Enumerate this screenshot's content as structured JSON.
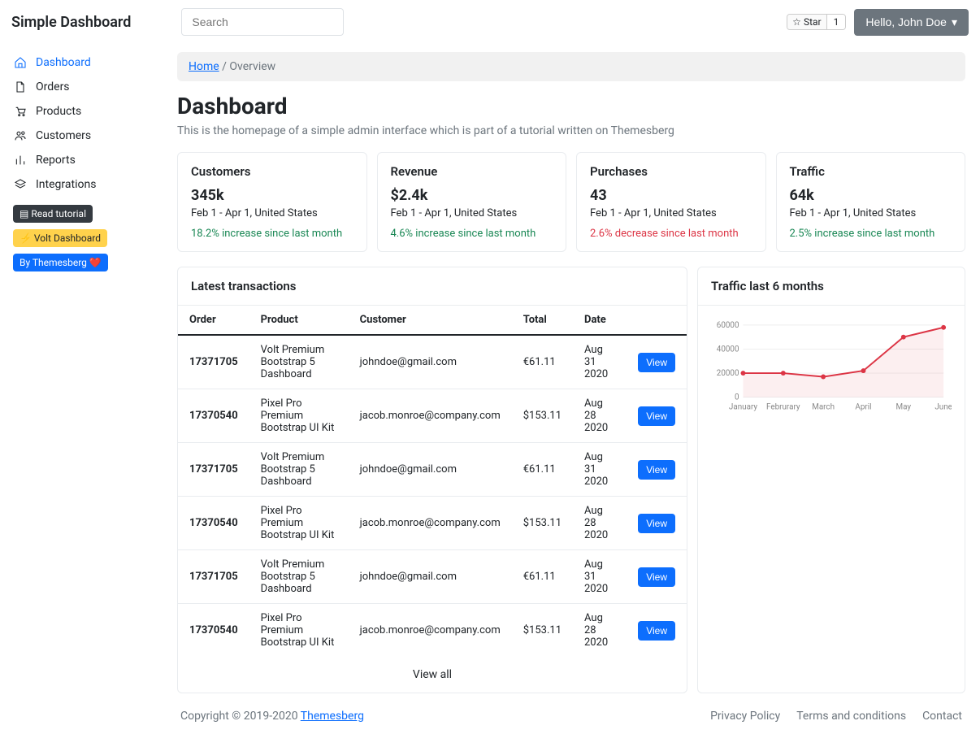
{
  "brand": "Simple Dashboard",
  "search": {
    "placeholder": "Search"
  },
  "star": {
    "label": "Star",
    "count": "1"
  },
  "user": {
    "greeting": "Hello, John Doe"
  },
  "sidebar": {
    "items": [
      {
        "label": "Dashboard"
      },
      {
        "label": "Orders"
      },
      {
        "label": "Products"
      },
      {
        "label": "Customers"
      },
      {
        "label": "Reports"
      },
      {
        "label": "Integrations"
      }
    ],
    "buttons": [
      {
        "label": "Read tutorial"
      },
      {
        "label": "Volt Dashboard"
      },
      {
        "label": "By Themesberg ❤️"
      }
    ]
  },
  "breadcrumb": {
    "home": "Home",
    "sep": "/",
    "current": "Overview"
  },
  "page": {
    "title": "Dashboard",
    "subtitle": "This is the homepage of a simple admin interface which is part of a tutorial written on Themesberg"
  },
  "stats": [
    {
      "label": "Customers",
      "value": "345k",
      "range": "Feb 1 - Apr 1, United States",
      "change": "18.2% increase since last month",
      "dir": "up"
    },
    {
      "label": "Revenue",
      "value": "$2.4k",
      "range": "Feb 1 - Apr 1, United States",
      "change": "4.6% increase since last month",
      "dir": "up"
    },
    {
      "label": "Purchases",
      "value": "43",
      "range": "Feb 1 - Apr 1, United States",
      "change": "2.6% decrease since last month",
      "dir": "down"
    },
    {
      "label": "Traffic",
      "value": "64k",
      "range": "Feb 1 - Apr 1, United States",
      "change": "2.5% increase since last month",
      "dir": "up"
    }
  ],
  "transactions": {
    "title": "Latest transactions",
    "headers": [
      "Order",
      "Product",
      "Customer",
      "Total",
      "Date",
      ""
    ],
    "rows": [
      {
        "order": "17371705",
        "product": "Volt Premium Bootstrap 5 Dashboard",
        "customer": "johndoe@gmail.com",
        "total": "€61.11",
        "date": "Aug 31 2020",
        "action": "View"
      },
      {
        "order": "17370540",
        "product": "Pixel Pro Premium Bootstrap UI Kit",
        "customer": "jacob.monroe@company.com",
        "total": "$153.11",
        "date": "Aug 28 2020",
        "action": "View"
      },
      {
        "order": "17371705",
        "product": "Volt Premium Bootstrap 5 Dashboard",
        "customer": "johndoe@gmail.com",
        "total": "€61.11",
        "date": "Aug 31 2020",
        "action": "View"
      },
      {
        "order": "17370540",
        "product": "Pixel Pro Premium Bootstrap UI Kit",
        "customer": "jacob.monroe@company.com",
        "total": "$153.11",
        "date": "Aug 28 2020",
        "action": "View"
      },
      {
        "order": "17371705",
        "product": "Volt Premium Bootstrap 5 Dashboard",
        "customer": "johndoe@gmail.com",
        "total": "€61.11",
        "date": "Aug 31 2020",
        "action": "View"
      },
      {
        "order": "17370540",
        "product": "Pixel Pro Premium Bootstrap UI Kit",
        "customer": "jacob.monroe@company.com",
        "total": "$153.11",
        "date": "Aug 28 2020",
        "action": "View"
      }
    ],
    "view_all": "View all"
  },
  "chart_panel": {
    "title": "Traffic last 6 months"
  },
  "chart_data": {
    "type": "area",
    "categories": [
      "January",
      "Februrary",
      "March",
      "April",
      "May",
      "June"
    ],
    "values": [
      20000,
      20000,
      17000,
      22000,
      50000,
      58000
    ],
    "ylim": [
      0,
      60000
    ],
    "yticks": [
      0,
      20000,
      40000,
      60000
    ]
  },
  "footer": {
    "copyright_prefix": "Copyright © 2019-2020 ",
    "copyright_link": "Themesberg",
    "links": [
      "Privacy Policy",
      "Terms and conditions",
      "Contact"
    ]
  }
}
